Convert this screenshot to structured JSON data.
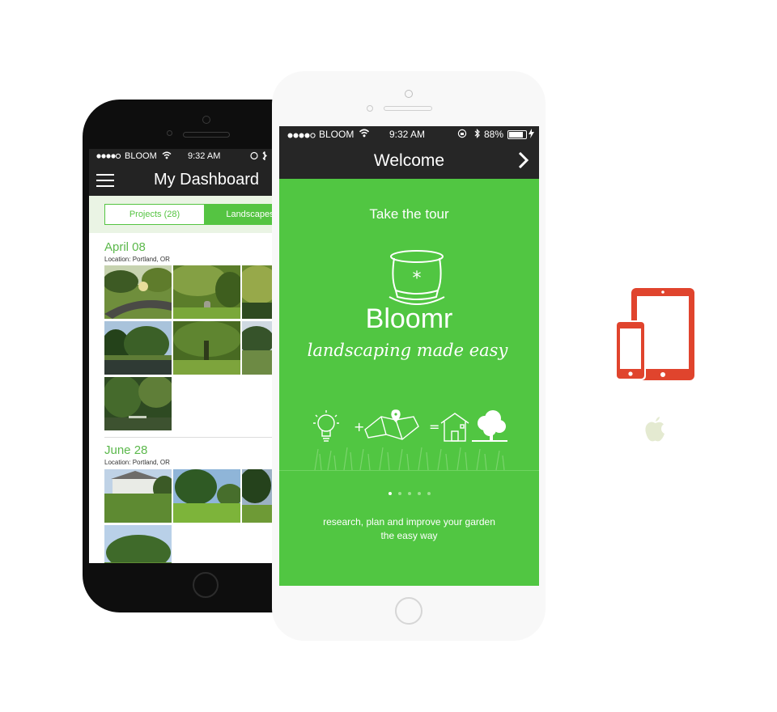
{
  "colors": {
    "accent_green": "#51c642",
    "dark_bar": "#262626",
    "device_icon": "#e0442d",
    "apple_logo": "#e4ead1"
  },
  "dashboard": {
    "status": {
      "carrier": "BLOOM",
      "time": "9:32 AM"
    },
    "title": "My Dashboard",
    "segments": [
      "Projects (28)",
      "Landscapes"
    ],
    "groups": [
      {
        "date": "April 08",
        "location": "Location: Portland, OR",
        "photo_count": 7
      },
      {
        "date": "June 28",
        "location": "Location: Portland, OR",
        "photo_count": 4
      }
    ]
  },
  "welcome": {
    "status": {
      "carrier": "BLOOM",
      "time": "9:32 AM",
      "battery": "88%"
    },
    "title": "Welcome",
    "tour": "Take the tour",
    "brand": "Bloomr",
    "tagline": "landscaping made easy",
    "equation": [
      "+",
      "="
    ],
    "pager": {
      "pages": 5,
      "active": 1
    },
    "subtitle_line1": "research, plan and improve your garden",
    "subtitle_line2": "the easy way"
  },
  "icons": [
    "menu-icon",
    "chevron-right-icon",
    "wifi-icon",
    "bluetooth-icon",
    "lightbulb-icon",
    "map-pin-icon",
    "house-icon",
    "tree-icon",
    "grass-icon",
    "top-hat-icon",
    "devices-icon",
    "apple-icon"
  ]
}
